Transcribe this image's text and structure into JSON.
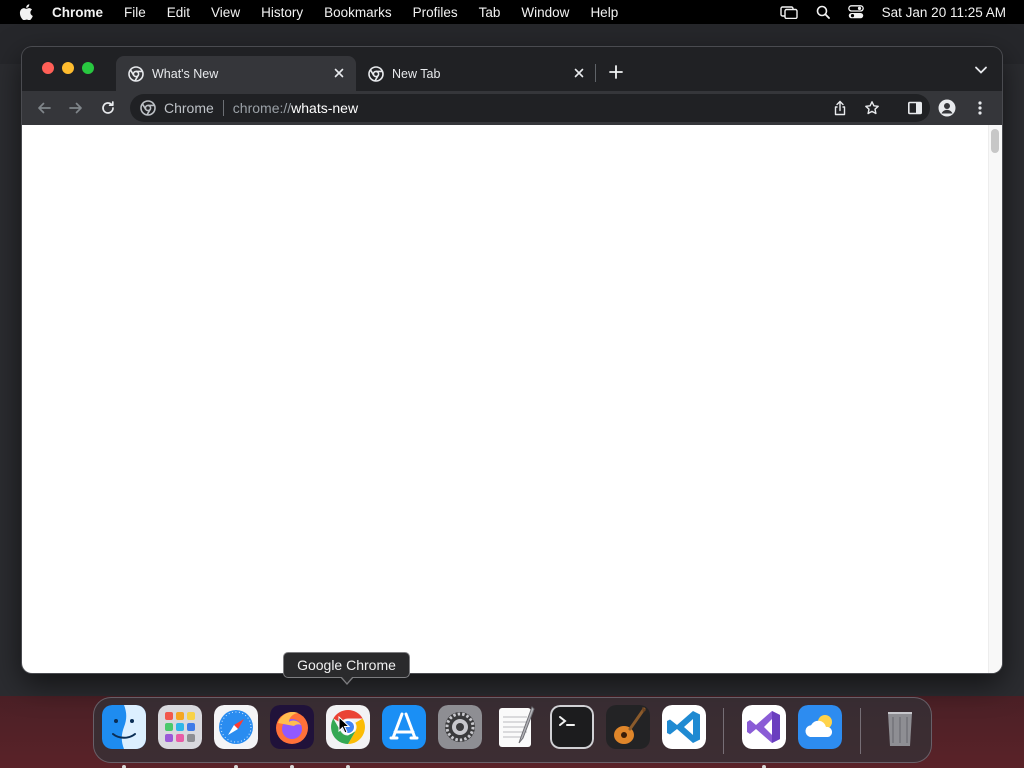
{
  "menubar": {
    "app_name": "Chrome",
    "items": [
      "File",
      "Edit",
      "View",
      "History",
      "Bookmarks",
      "Profiles",
      "Tab",
      "Window",
      "Help"
    ],
    "clock": "Sat Jan 20  11:25 AM"
  },
  "browser": {
    "tabs": [
      {
        "title": "What's New",
        "active": true
      },
      {
        "title": "New Tab",
        "active": false
      }
    ],
    "omnibox": {
      "chip": "Chrome",
      "url_scheme": "chrome://",
      "url_host": "whats-new"
    }
  },
  "tooltip": {
    "label": "Google Chrome"
  },
  "dock": {
    "items": [
      {
        "name": "Finder",
        "icon": "finder-icon",
        "running": true
      },
      {
        "name": "Launchpad",
        "icon": "launchpad-icon",
        "running": false
      },
      {
        "name": "Safari",
        "icon": "safari-icon",
        "running": true
      },
      {
        "name": "Firefox",
        "icon": "firefox-icon",
        "running": true
      },
      {
        "name": "Google Chrome",
        "icon": "chrome-icon",
        "running": true
      },
      {
        "name": "App Store",
        "icon": "app-store-icon",
        "running": false
      },
      {
        "name": "System Settings",
        "icon": "system-settings-icon",
        "running": false
      },
      {
        "name": "TextEdit",
        "icon": "textedit-icon",
        "running": false
      },
      {
        "name": "Terminal",
        "icon": "terminal-icon",
        "running": false
      },
      {
        "name": "GarageBand",
        "icon": "garageband-icon",
        "running": false
      },
      {
        "name": "Visual Studio Code",
        "icon": "vscode-icon",
        "running": false
      },
      {
        "name": "Visual Studio",
        "icon": "visual-studio-icon",
        "running": true
      },
      {
        "name": "Weather",
        "icon": "weather-icon",
        "running": false
      },
      {
        "name": "Trash",
        "icon": "trash-icon",
        "running": false
      }
    ]
  },
  "colors": {
    "traffic_close": "#ff5f57",
    "traffic_minimize": "#febc2e",
    "traffic_maximize": "#28c840",
    "tab_strip": "#202124",
    "toolbar": "#35363a"
  }
}
